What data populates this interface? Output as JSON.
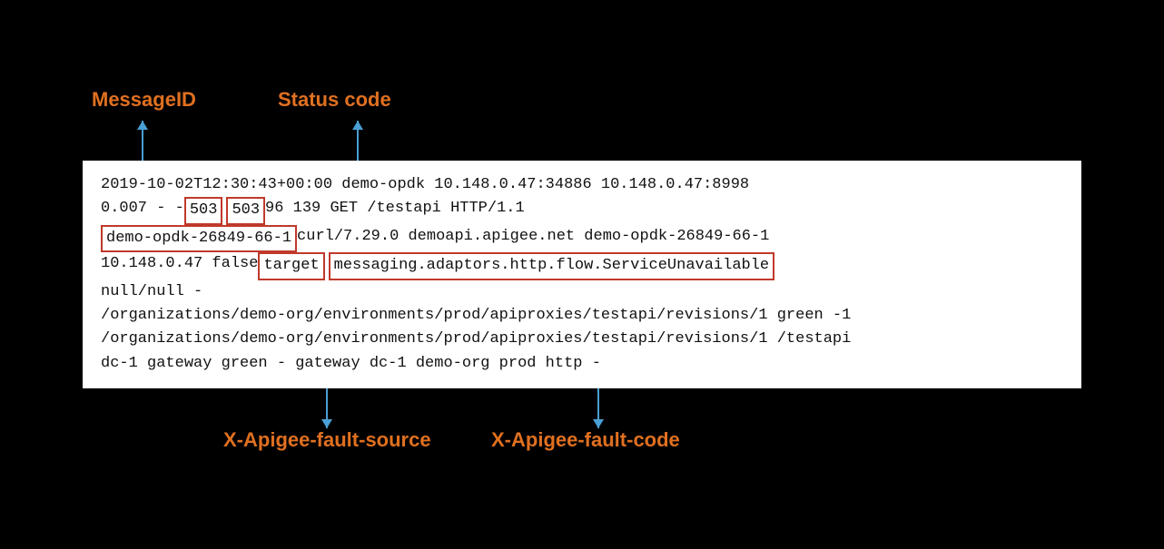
{
  "labels": {
    "messageID": "MessageID",
    "statusCode": "Status code",
    "faultSource": "X-Apigee-fault-source",
    "faultCode": "X-Apigee-fault-code"
  },
  "log": {
    "line1": "2019-10-02T12:30:43+00:00   demo-opdk      10.148.0.47:34886      10.148.0.47:8998",
    "line2_pre": "0.007   -   -   ",
    "line2_503a": "503",
    "line2_503b": "503",
    "line2_post": "   96   139   GET /testapi HTTP/1.1",
    "line3_highlighted": "demo-opdk-26849-66-1",
    "line3_post": "   curl/7.29.0      demoapi.apigee.net   demo-opdk-26849-66-1",
    "line4_pre": "10.148.0.47   false   ",
    "line4_target": "target",
    "line4_fault": "messaging.adaptors.http.flow.ServiceUnavailable",
    "line5": "null/null   -",
    "line6": "/organizations/demo-org/environments/prod/apiproxies/testapi/revisions/1  green   -1",
    "line7": "/organizations/demo-org/environments/prod/apiproxies/testapi/revisions/1      /testapi",
    "line8": "dc-1   gateway  green   -     gateway  dc-1   demo-org    prod   http   -"
  }
}
